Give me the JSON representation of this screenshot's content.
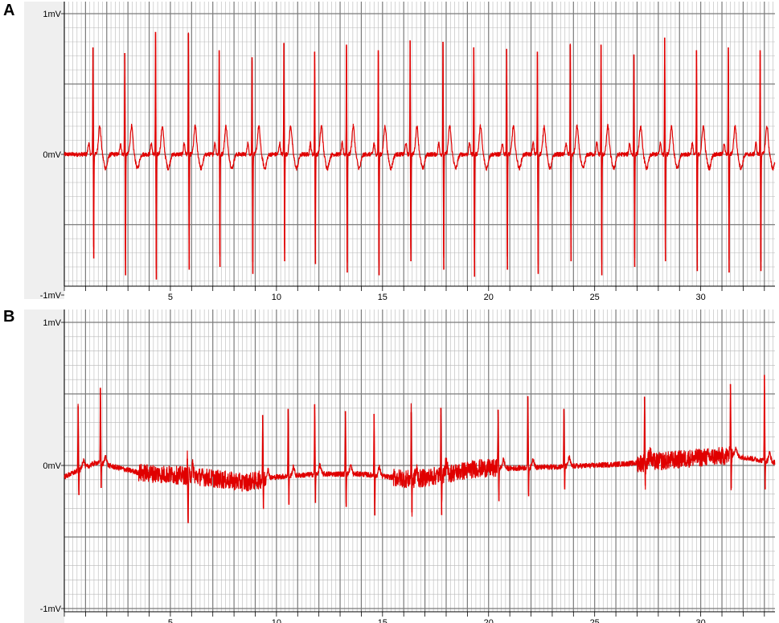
{
  "panels": [
    {
      "letter": "A"
    },
    {
      "letter": "B"
    }
  ],
  "colors": {
    "trace": "#e00000",
    "grid_major": "#7a7a7a",
    "grid_minor": "#b8b8b8",
    "label_band": "#efefef",
    "axis_text": "#000000"
  },
  "chart_data": [
    {
      "type": "line",
      "panel": "A",
      "title": "",
      "xlabel": "",
      "ylabel": "",
      "y_tick_labels": [
        "1mV",
        "0mV",
        "-1mV"
      ],
      "y_ticks": [
        1,
        0,
        -1
      ],
      "ylim": [
        -1,
        1
      ],
      "x_tick_labels": [
        "5",
        "10",
        "15",
        "20",
        "25",
        "30"
      ],
      "x_ticks": [
        5,
        10,
        15,
        20,
        25,
        30
      ],
      "xlim": [
        0,
        33.5
      ],
      "grid": true,
      "series": [
        {
          "values_description": "",
          "baseline": 0,
          "qrs_times": [
            1.35,
            2.85,
            4.3,
            5.85,
            7.3,
            8.85,
            10.35,
            11.8,
            13.3,
            14.8,
            16.3,
            17.85,
            19.3,
            20.85,
            22.3,
            23.85,
            25.3,
            26.85,
            28.3,
            29.8,
            31.3,
            32.8
          ],
          "r_amplitudes": [
            0.76,
            0.72,
            0.87,
            0.86,
            0.74,
            0.69,
            0.79,
            0.73,
            0.78,
            0.74,
            0.81,
            0.8,
            0.76,
            0.75,
            0.73,
            0.78,
            0.78,
            0.71,
            0.83,
            0.74,
            0.76,
            0.74
          ],
          "s_amplitudes": [
            -0.74,
            -0.86,
            -0.89,
            -0.82,
            -0.8,
            -0.85,
            -0.76,
            -0.78,
            -0.84,
            -0.86,
            -0.76,
            -0.82,
            -0.87,
            -0.82,
            -0.85,
            -0.76,
            -0.86,
            -0.8,
            -0.76,
            -0.83,
            -0.84,
            -0.83
          ],
          "t_wave_amplitude": 0.2,
          "noise": 0.015
        }
      ]
    },
    {
      "type": "line",
      "panel": "B",
      "title": "",
      "xlabel": "",
      "ylabel": "",
      "y_tick_labels": [
        "1mV",
        "0mV",
        "-1mV"
      ],
      "y_ticks": [
        1,
        0,
        -1
      ],
      "ylim": [
        -1,
        1
      ],
      "x_tick_labels": [
        "5",
        "10",
        "15",
        "20",
        "25",
        "30"
      ],
      "x_ticks": [
        5,
        10,
        15,
        20,
        25,
        30
      ],
      "xlim": [
        0,
        33.5
      ],
      "grid": true,
      "series": [
        {
          "qrs_times": [
            0.65,
            1.7,
            5.8,
            9.35,
            10.55,
            11.8,
            13.25,
            14.6,
            16.35,
            17.75,
            20.45,
            21.85,
            23.55,
            27.35,
            31.4,
            33.0
          ],
          "r_amplitudes": [
            0.45,
            0.53,
            0.12,
            0.45,
            0.47,
            0.49,
            0.44,
            0.43,
            0.47,
            0.47,
            0.41,
            0.5,
            0.4,
            0.46,
            0.5,
            0.6
          ],
          "s_amplitudes": [
            -0.17,
            -0.17,
            -0.33,
            -0.2,
            -0.2,
            -0.2,
            -0.23,
            -0.28,
            -0.23,
            -0.28,
            -0.23,
            -0.2,
            -0.16,
            -0.16,
            -0.23,
            -0.2
          ],
          "baseline_points": [
            [
              0,
              -0.08
            ],
            [
              1.5,
              0.02
            ],
            [
              3.5,
              -0.05
            ],
            [
              6.5,
              -0.08
            ],
            [
              8.5,
              -0.12
            ],
            [
              10,
              -0.08
            ],
            [
              12,
              -0.06
            ],
            [
              14,
              -0.06
            ],
            [
              16.5,
              -0.1
            ],
            [
              18,
              -0.06
            ],
            [
              19.5,
              -0.02
            ],
            [
              21,
              -0.02
            ],
            [
              23,
              -0.01
            ],
            [
              25,
              0.0
            ],
            [
              27.5,
              0.02
            ],
            [
              29.5,
              0.05
            ],
            [
              31.5,
              0.07
            ],
            [
              33.5,
              0.02
            ]
          ],
          "noise_segments": [
            [
              3.5,
              9.5
            ],
            [
              15.5,
              20.5
            ],
            [
              27.0,
              31.5
            ]
          ],
          "noise": 0.018
        }
      ]
    }
  ]
}
